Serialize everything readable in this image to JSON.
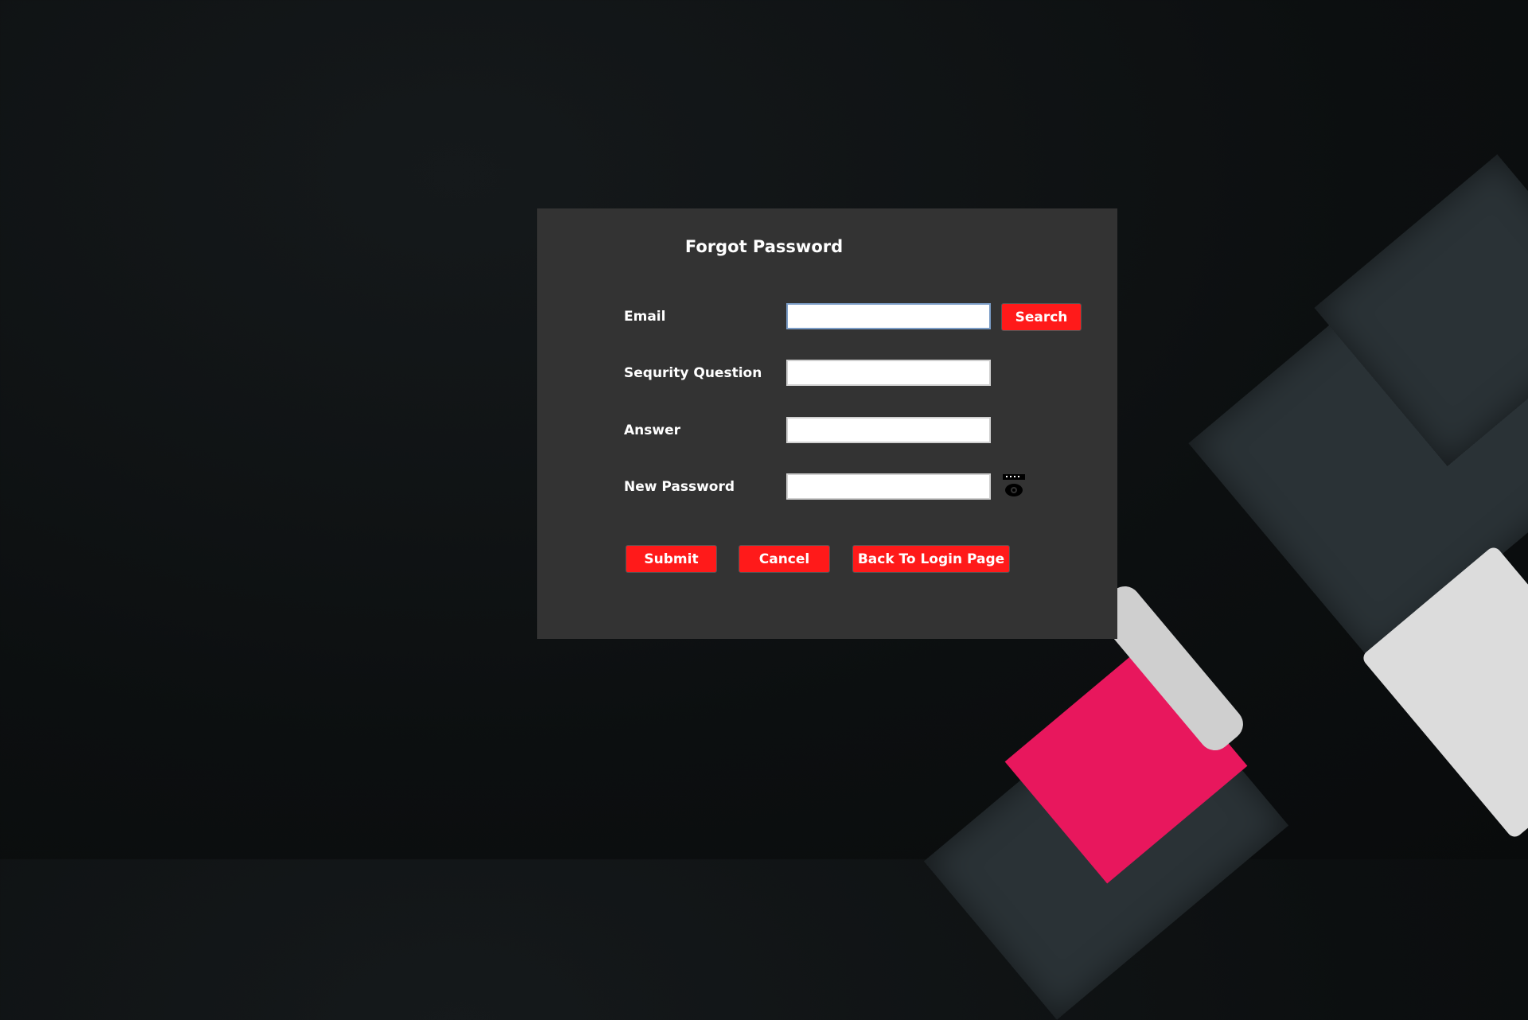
{
  "dialog": {
    "title": "Forgot Password"
  },
  "form": {
    "email_label": "Email",
    "email_value": "",
    "question_label": "Sequrity Question",
    "question_value": "",
    "answer_label": "Answer",
    "answer_value": "",
    "password_label": "New Password",
    "password_value": ""
  },
  "buttons": {
    "search": "Search",
    "submit": "Submit",
    "cancel": "Cancel",
    "back": "Back To Login Page"
  },
  "icons": {
    "password_toggle": "eye-icon"
  },
  "colors": {
    "accent": "#ff1a1a",
    "panel": "#333333"
  }
}
